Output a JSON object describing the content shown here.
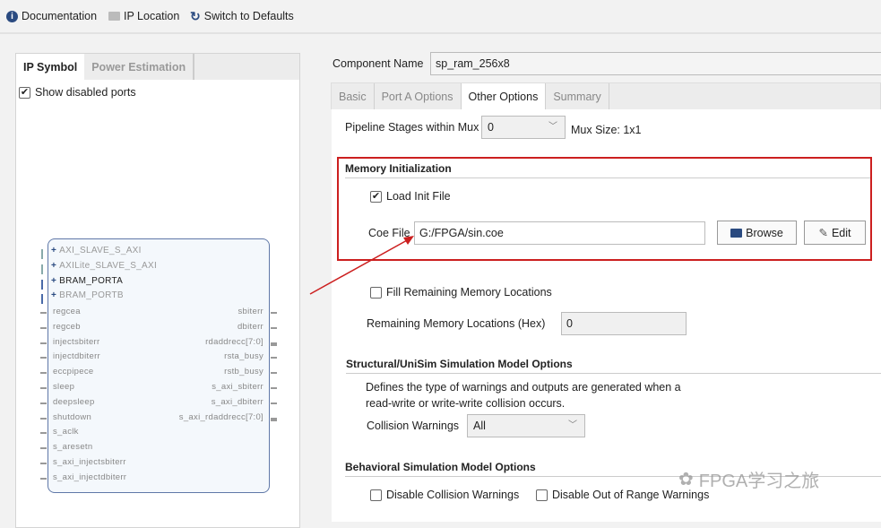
{
  "toolbar": {
    "documentation": "Documentation",
    "ip_location": "IP Location",
    "switch_defaults": "Switch to Defaults"
  },
  "left": {
    "tabs": [
      {
        "label": "IP Symbol",
        "active": true
      },
      {
        "label": "Power Estimation",
        "active": false
      }
    ],
    "show_disabled_ports": {
      "label": "Show disabled ports",
      "checked": true
    },
    "symbol": {
      "buses": [
        "AXI_SLAVE_S_AXI",
        "AXILite_SLAVE_S_AXI",
        "BRAM_PORTA",
        "BRAM_PORTB"
      ],
      "left_ports": [
        "regcea",
        "regceb",
        "injectsbiterr",
        "injectdbiterr",
        "eccpipece",
        "sleep",
        "deepsleep",
        "shutdown",
        "s_aclk",
        "s_aresetn",
        "s_axi_injectsbiterr",
        "s_axi_injectdbiterr"
      ],
      "right_ports": [
        "sbiterr",
        "dbiterr",
        "rdaddrecc[7:0]",
        "rsta_busy",
        "rstb_busy",
        "s_axi_sbiterr",
        "s_axi_dbiterr",
        "s_axi_rdaddrecc[7:0]"
      ]
    }
  },
  "right": {
    "component_name_label": "Component Name",
    "component_name": "sp_ram_256x8",
    "tabs": [
      {
        "label": "Basic"
      },
      {
        "label": "Port A Options"
      },
      {
        "label": "Other Options",
        "active": true
      },
      {
        "label": "Summary"
      }
    ],
    "pipeline_label": "Pipeline Stages within Mux",
    "pipeline_value": "0",
    "mux_size": "Mux Size: 1x1",
    "mem_init": {
      "title": "Memory Initialization",
      "load_init_label": "Load Init File",
      "load_init_checked": true,
      "coe_label": "Coe File",
      "coe_value": "G:/FPGA/sin.coe",
      "browse": "Browse",
      "edit": "Edit"
    },
    "fill_remaining": {
      "label": "Fill Remaining Memory Locations",
      "checked": false
    },
    "remaining_label": "Remaining Memory Locations (Hex)",
    "remaining_value": "0",
    "structural": {
      "title": "Structural/UniSim Simulation Model Options",
      "desc1": "Defines the type of warnings and outputs are generated when a",
      "desc2": "read-write or write-write collision occurs.",
      "collision_label": "Collision Warnings",
      "collision_value": "All"
    },
    "behavioral": {
      "title": "Behavioral Simulation Model Options",
      "disable_collision": "Disable Collision Warnings",
      "disable_oor": "Disable Out of Range Warnings"
    }
  },
  "highlight_color": "#cc1f1f",
  "watermark": "FPGA学习之旅"
}
